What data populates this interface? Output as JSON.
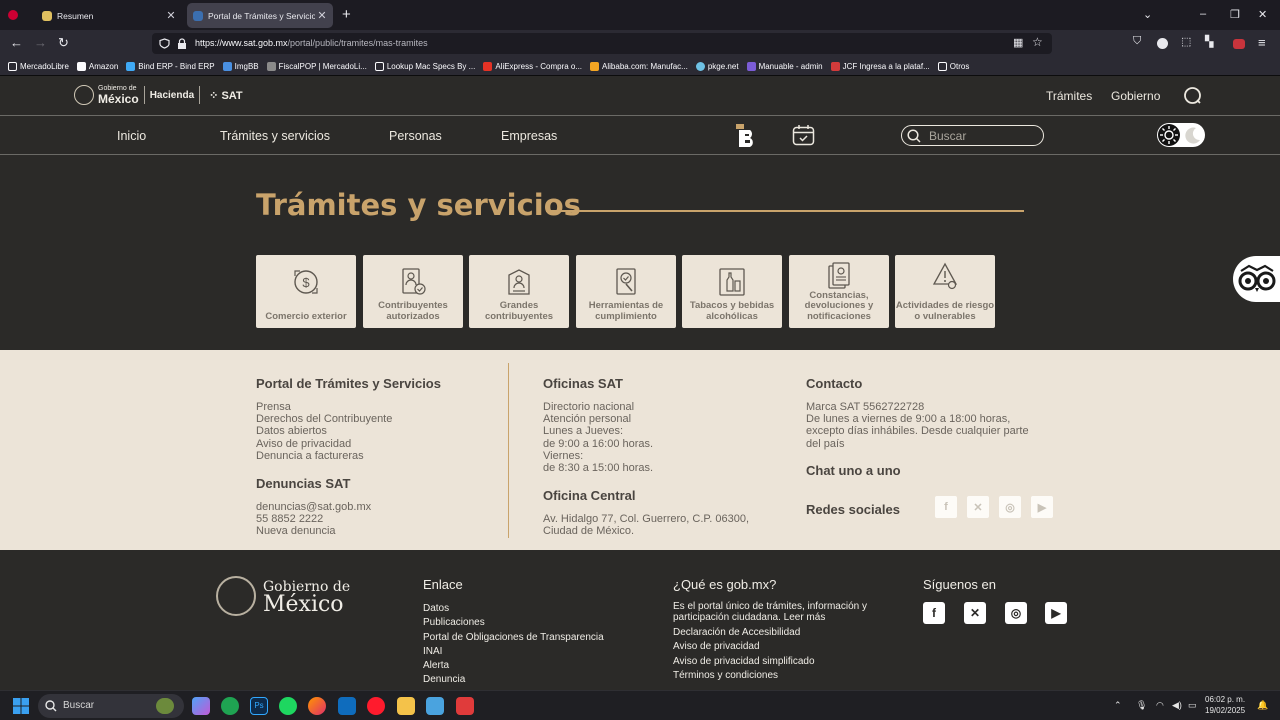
{
  "browser": {
    "tabs": [
      {
        "title": "Resumen",
        "active": false
      },
      {
        "title": "Portal de Trámites y Servicios de",
        "active": true
      }
    ],
    "url_domain": "https://www.sat.gob.mx",
    "url_path": "/portal/public/tramites/mas-tramites",
    "bookmarks": [
      "MercadoLibre",
      "Amazon",
      "Bind ERP - Bind ERP",
      "ImgBB",
      "FiscalPOP | MercadoLi...",
      "Lookup Mac Specs By ...",
      "AliExpress - Compra o...",
      "Alibaba.com: Manufac...",
      "pkge.net",
      "Manuable - admin",
      "JCF Ingresa a la plataf..."
    ],
    "bookmarks_folder": "Otros"
  },
  "header": {
    "gob_small": "Gobierno de",
    "gob_big": "México",
    "hacienda": "Hacienda",
    "sat": "SAT",
    "links": [
      "Trámites",
      "Gobierno"
    ]
  },
  "menu": {
    "items": [
      "Inicio",
      "Trámites y servicios",
      "Personas",
      "Empresas"
    ],
    "search_placeholder": "Buscar"
  },
  "main": {
    "title": "Trámites y servicios",
    "cards": [
      {
        "label": "Comercio exterior",
        "icon": "money-exchange-icon"
      },
      {
        "label": "Contribuyentes autorizados",
        "icon": "authorized-taxpayer-icon"
      },
      {
        "label": "Grandes contribuyentes",
        "icon": "large-taxpayer-icon"
      },
      {
        "label": "Herramientas de cumplimiento",
        "icon": "compliance-tools-icon"
      },
      {
        "label": "Tabacos y bebidas alcohólicas",
        "icon": "tobacco-alcohol-icon"
      },
      {
        "label": "Constancias, devoluciones y notificaciones",
        "icon": "certificates-icon"
      },
      {
        "label": "Actividades de riesgo o vulnerables",
        "icon": "risk-activities-icon"
      }
    ]
  },
  "info": {
    "portal_title": "Portal de Trámites y Servicios",
    "portal_links": [
      "Prensa",
      "Derechos del Contribuyente",
      "Datos abiertos",
      "Aviso de privacidad",
      "Denuncia a factureras"
    ],
    "denuncias_title": "Denuncias SAT",
    "denuncias_lines": [
      "denuncias@sat.gob.mx",
      "55 8852 2222",
      "Nueva denuncia"
    ],
    "oficinas_title": "Oficinas SAT",
    "oficinas_lines": [
      "Directorio nacional",
      "Atención personal",
      "Lunes a Jueves:",
      "de 9:00 a 16:00 horas.",
      "Viernes:",
      "de 8:30 a 15:00 horas."
    ],
    "central_title": "Oficina Central",
    "central_lines": [
      "Av. Hidalgo 77, Col. Guerrero, C.P. 06300,",
      "Ciudad de México."
    ],
    "contacto_title": "Contacto",
    "contacto_lines": [
      "Marca SAT 5562722728",
      "De lunes a viernes de 9:00 a 18:00 horas,",
      "excepto días inhábiles. Desde cualquier parte",
      "del país"
    ],
    "chat_title": "Chat uno a uno",
    "redes_title": "Redes sociales"
  },
  "footer": {
    "gob_small": "Gobierno de",
    "gob_big": "México",
    "enlace_title": "Enlace",
    "enlace_links": [
      "Datos",
      "Publicaciones",
      "Portal de Obligaciones de Transparencia",
      "INAI",
      "Alerta",
      "Denuncia"
    ],
    "que_title": "¿Qué es gob.mx?",
    "que_lines": [
      "Es el portal único de trámites, información y",
      "participación ciudadana. Leer más",
      "Declaración de Accesibilidad",
      "Aviso de privacidad",
      "Aviso de privacidad simplificado",
      "Términos y condiciones"
    ],
    "siguenos_title": "Síguenos en"
  },
  "taskbar": {
    "search_placeholder": "Buscar",
    "time": "06:02 p. m.",
    "date": "19/02/2025"
  }
}
